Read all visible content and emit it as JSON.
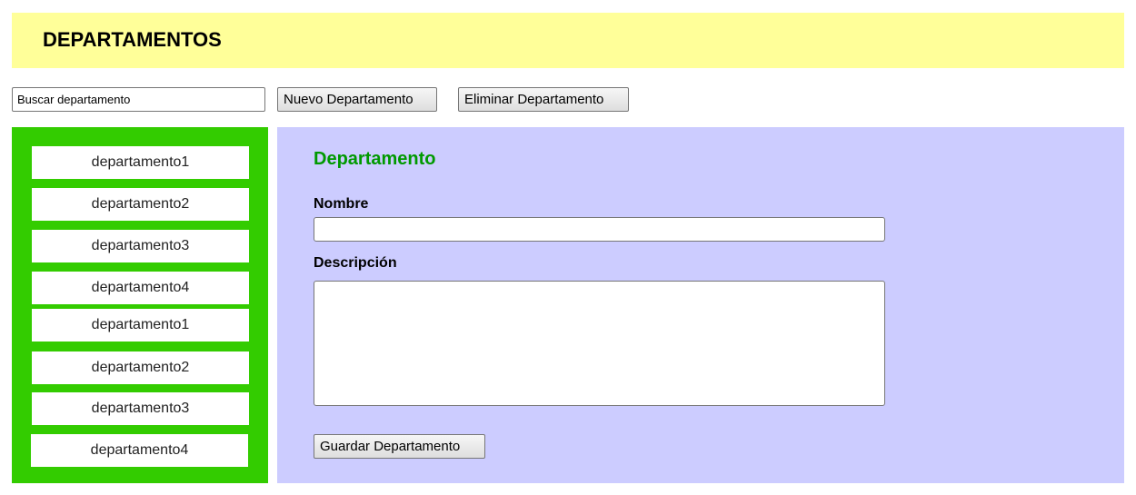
{
  "header": {
    "title": "DEPARTAMENTOS"
  },
  "toolbar": {
    "search_placeholder": "Buscar departamento",
    "new_label": "Nuevo Departamento",
    "delete_label": "Eliminar Departamento"
  },
  "sidebar": {
    "items": [
      {
        "label": "departamento1"
      },
      {
        "label": "departamento2"
      },
      {
        "label": "departamento3"
      },
      {
        "label": "departamento4"
      },
      {
        "label": "departamento1"
      },
      {
        "label": "departamento2"
      },
      {
        "label": "departamento3"
      },
      {
        "label": "departamento4"
      }
    ]
  },
  "form": {
    "title": "Departamento",
    "name_label": "Nombre",
    "name_value": "",
    "description_label": "Descripción",
    "description_value": "",
    "save_label": "Guardar Departamento"
  },
  "colors": {
    "header_bg": "#ffff99",
    "sidebar_bg": "#33cc00",
    "panel_bg": "#ccccff",
    "title_green": "#009900"
  }
}
